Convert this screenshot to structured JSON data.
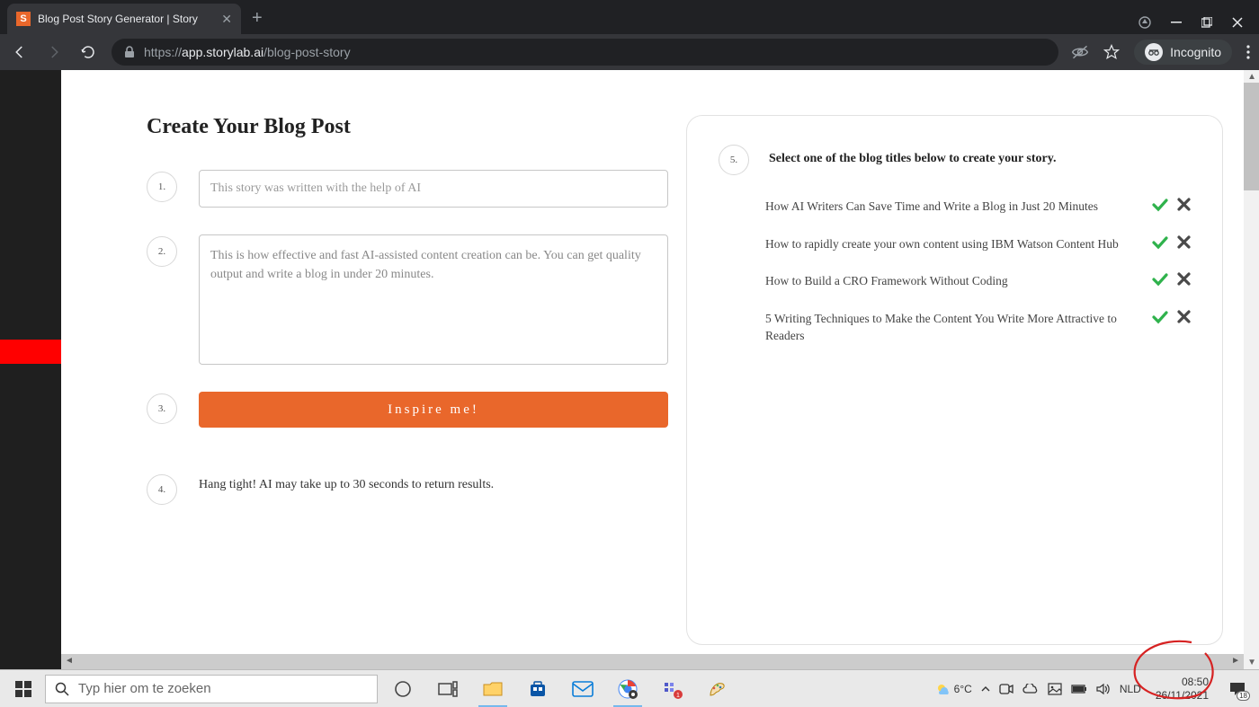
{
  "browser": {
    "tab_title": "Blog Post Story Generator | Story",
    "url_prefix": "https://",
    "url_domain": "app.storylab.ai",
    "url_path": "/blog-post-story",
    "incognito_label": "Incognito"
  },
  "page": {
    "heading": "Create Your Blog Post",
    "step1_num": "1.",
    "step1_placeholder": "This story was written with the help of AI",
    "step2_num": "2.",
    "step2_value": "This is how effective and fast AI-assisted content creation can be. You can get quality output and write a blog in under 20 minutes.",
    "step3_num": "3.",
    "inspire_label": "Inspire me!",
    "step4_num": "4.",
    "hang_text": "Hang tight! AI may take up to 30 seconds to return results.",
    "step5_num": "5.",
    "step5_label": "Select one of the blog titles below to create your story.",
    "titles": [
      " How AI Writers Can Save Time and Write a Blog in Just 20 Minutes",
      " How to rapidly create your own content using IBM Watson Content Hub",
      " How to Build a CRO Framework Without Coding",
      " 5 Writing Techniques to Make the Content You Write More Attractive to Readers"
    ]
  },
  "taskbar": {
    "search_placeholder": "Typ hier om te zoeken",
    "temp": "6°C",
    "lang": "NLD",
    "time": "08:50",
    "date": "26/11/2021",
    "notif_count": "18"
  }
}
